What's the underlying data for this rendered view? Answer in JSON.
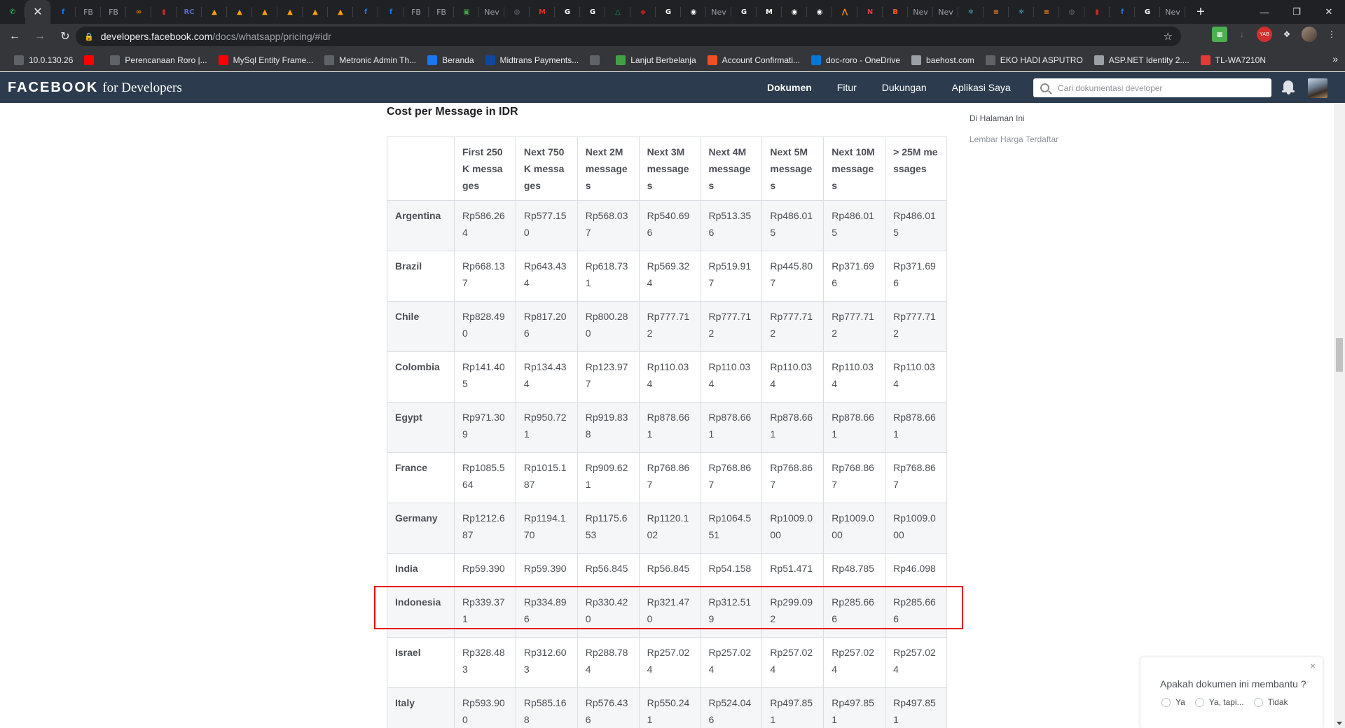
{
  "browser": {
    "tabs": [
      {
        "icon": "whatsapp-icon",
        "color": "#25d366",
        "glyph": "✆"
      },
      {
        "icon": "close-icon",
        "active": true
      },
      {
        "icon": "facebook-icon",
        "color": "#1877f2",
        "glyph": "f"
      },
      {
        "icon": "fb-text",
        "text": "FB"
      },
      {
        "icon": "fb-text",
        "text": "FB"
      },
      {
        "icon": "link-icon",
        "color": "#f57c00",
        "glyph": "∞"
      },
      {
        "icon": "app-icon",
        "color": "#c62828",
        "glyph": "▮"
      },
      {
        "icon": "rc-icon",
        "color": "#5c6bc0",
        "glyph": "RC"
      },
      {
        "icon": "fire-icon",
        "color": "#ffa000",
        "glyph": "▲"
      },
      {
        "icon": "fire-icon",
        "color": "#ffa000",
        "glyph": "▲"
      },
      {
        "icon": "fire-icon",
        "color": "#ffa000",
        "glyph": "▲"
      },
      {
        "icon": "fire-icon",
        "color": "#ffa000",
        "glyph": "▲"
      },
      {
        "icon": "fire-icon",
        "color": "#ffa000",
        "glyph": "▲"
      },
      {
        "icon": "fire-icon",
        "color": "#ffa000",
        "glyph": "▲"
      },
      {
        "icon": "facebook-round-icon",
        "color": "#1877f2",
        "glyph": "f"
      },
      {
        "icon": "facebook-icon",
        "color": "#1877f2",
        "glyph": "f"
      },
      {
        "icon": "fb-text",
        "text": "FB"
      },
      {
        "icon": "fb-text",
        "text": "FB"
      },
      {
        "icon": "course-icon",
        "color": "#43a047",
        "glyph": "▣"
      },
      {
        "icon": "new-tab-text",
        "text": "Nev"
      },
      {
        "icon": "globe-icon",
        "color": "#5f6368",
        "glyph": "◍"
      },
      {
        "icon": "gmail-icon",
        "color": "#d93025",
        "glyph": "M"
      },
      {
        "icon": "google-icon",
        "color": "#ffffff",
        "glyph": "G"
      },
      {
        "icon": "google-icon",
        "color": "#ffffff",
        "glyph": "G"
      },
      {
        "icon": "drive-icon",
        "color": "#0f9d58",
        "glyph": "△"
      },
      {
        "icon": "shield-icon",
        "color": "#b71c1c",
        "glyph": "◆"
      },
      {
        "icon": "google-icon",
        "color": "#ffffff",
        "glyph": "G"
      },
      {
        "icon": "github-icon",
        "color": "#ffffff",
        "glyph": "◉"
      },
      {
        "icon": "new-tab-text",
        "text": "Nev"
      },
      {
        "icon": "google-icon",
        "color": "#ffffff",
        "glyph": "G"
      },
      {
        "icon": "medium-icon",
        "color": "#ffffff",
        "glyph": "M"
      },
      {
        "icon": "github-icon",
        "color": "#ffffff",
        "glyph": "◉"
      },
      {
        "icon": "github-icon",
        "color": "#ffffff",
        "glyph": "◉"
      },
      {
        "icon": "bars-icon",
        "color": "#ff9800",
        "glyph": "⋀"
      },
      {
        "icon": "inbox-icon",
        "color": "#e53935",
        "glyph": "N"
      },
      {
        "icon": "blogger-icon",
        "color": "#ff5722",
        "glyph": "B"
      },
      {
        "icon": "new-tab-text",
        "text": "Nev"
      },
      {
        "icon": "new-tab-text",
        "text": "Nev"
      },
      {
        "icon": "react-icon",
        "color": "#61dafb",
        "glyph": "⚛"
      },
      {
        "icon": "stack-icon",
        "color": "#f48024",
        "glyph": "≡"
      },
      {
        "icon": "react-icon",
        "color": "#61dafb",
        "glyph": "⚛"
      },
      {
        "icon": "stack-icon",
        "color": "#f48024",
        "glyph": "≡"
      },
      {
        "icon": "globe-icon",
        "color": "#5f6368",
        "glyph": "◍"
      },
      {
        "icon": "app-icon",
        "color": "#c62828",
        "glyph": "▮"
      },
      {
        "icon": "facebook-icon",
        "color": "#1877f2",
        "glyph": "f"
      },
      {
        "icon": "google-icon",
        "color": "#ffffff",
        "glyph": "G"
      },
      {
        "icon": "new-tab-text",
        "text": "Nev"
      }
    ],
    "url_host": "developers.facebook.com",
    "url_path": "/docs/whatsapp/pricing/#idr",
    "bookmarks": [
      {
        "icon": "globe-icon",
        "color": "#5f6368",
        "label": "10.0.130.26"
      },
      {
        "icon": "youtube-icon",
        "color": "#ff0000",
        "label": ""
      },
      {
        "icon": "globe-icon",
        "color": "#5f6368",
        "label": "Perencanaan Roro |..."
      },
      {
        "icon": "youtube-icon",
        "color": "#ff0000",
        "label": "MySql Entity Frame..."
      },
      {
        "icon": "globe-icon",
        "color": "#5f6368",
        "label": "Metronic Admin Th..."
      },
      {
        "icon": "facebook-icon",
        "color": "#1877f2",
        "label": "Beranda"
      },
      {
        "icon": "midtrans-icon",
        "color": "#0d47a1",
        "label": "Midtrans Payments..."
      },
      {
        "icon": "globe-icon",
        "color": "#5f6368",
        "label": ""
      },
      {
        "icon": "course-icon",
        "color": "#43a047",
        "label": "Lanjut Berbelanja"
      },
      {
        "icon": "microsoft-icon",
        "color": "#f25022",
        "label": "Account Confirmati..."
      },
      {
        "icon": "onedrive-icon",
        "color": "#0078d4",
        "label": "doc-roro - OneDrive"
      },
      {
        "icon": "search-icon",
        "color": "#9aa0a6",
        "label": "baehost.com"
      },
      {
        "icon": "globe-icon",
        "color": "#5f6368",
        "label": "EKO HADI ASPUTRO"
      },
      {
        "icon": "dotnet-icon",
        "color": "#9aa0a6",
        "label": "ASP.NET Identity 2...."
      },
      {
        "icon": "tplink-icon",
        "color": "#e53935",
        "label": "TL-WA7210N"
      }
    ]
  },
  "fb": {
    "logo": "FACEBOOK",
    "logo_sub": "for Developers",
    "nav": [
      "Dokumen",
      "Fitur",
      "Dukungan",
      "Aplikasi Saya"
    ],
    "search_placeholder": "Cari dokumentasi developer"
  },
  "page": {
    "section_title": "Cost per Message in IDR",
    "toc_head": "Di Halaman Ini",
    "toc_link": "Lembar Harga Terdaftar"
  },
  "table": {
    "headers": [
      "First 250K messages",
      "Next 750K messages",
      "Next 2M messages",
      "Next 3M messages",
      "Next 4M messages",
      "Next 5M messages",
      "Next 10M messages",
      "> 25M messages"
    ],
    "rows": [
      {
        "country": "Argentina",
        "values": [
          "Rp586.264",
          "Rp577.150",
          "Rp568.037",
          "Rp540.696",
          "Rp513.356",
          "Rp486.015",
          "Rp486.015",
          "Rp486.015"
        ]
      },
      {
        "country": "Brazil",
        "values": [
          "Rp668.137",
          "Rp643.434",
          "Rp618.731",
          "Rp569.324",
          "Rp519.917",
          "Rp445.807",
          "Rp371.696",
          "Rp371.696"
        ]
      },
      {
        "country": "Chile",
        "values": [
          "Rp828.490",
          "Rp817.206",
          "Rp800.280",
          "Rp777.712",
          "Rp777.712",
          "Rp777.712",
          "Rp777.712",
          "Rp777.712"
        ]
      },
      {
        "country": "Colombia",
        "values": [
          "Rp141.405",
          "Rp134.434",
          "Rp123.977",
          "Rp110.034",
          "Rp110.034",
          "Rp110.034",
          "Rp110.034",
          "Rp110.034"
        ]
      },
      {
        "country": "Egypt",
        "values": [
          "Rp971.309",
          "Rp950.721",
          "Rp919.838",
          "Rp878.661",
          "Rp878.661",
          "Rp878.661",
          "Rp878.661",
          "Rp878.661"
        ]
      },
      {
        "country": "France",
        "values": [
          "Rp1085.564",
          "Rp1015.187",
          "Rp909.621",
          "Rp768.867",
          "Rp768.867",
          "Rp768.867",
          "Rp768.867",
          "Rp768.867"
        ]
      },
      {
        "country": "Germany",
        "values": [
          "Rp1212.687",
          "Rp1194.170",
          "Rp1175.653",
          "Rp1120.102",
          "Rp1064.551",
          "Rp1009.000",
          "Rp1009.000",
          "Rp1009.000"
        ]
      },
      {
        "country": "India",
        "values": [
          "Rp59.390",
          "Rp59.390",
          "Rp56.845",
          "Rp56.845",
          "Rp54.158",
          "Rp51.471",
          "Rp48.785",
          "Rp46.098"
        ]
      },
      {
        "country": "Indonesia",
        "values": [
          "Rp339.371",
          "Rp334.896",
          "Rp330.420",
          "Rp321.470",
          "Rp312.519",
          "Rp299.092",
          "Rp285.666",
          "Rp285.666"
        ]
      },
      {
        "country": "Israel",
        "values": [
          "Rp328.483",
          "Rp312.603",
          "Rp288.784",
          "Rp257.024",
          "Rp257.024",
          "Rp257.024",
          "Rp257.024",
          "Rp257.024"
        ]
      },
      {
        "country": "Italy",
        "values": [
          "Rp593.900",
          "Rp585.168",
          "Rp576.436",
          "Rp550.241",
          "Rp524.046",
          "Rp497.851",
          "Rp497.851",
          "Rp497.851"
        ]
      }
    ]
  },
  "feedback": {
    "question": "Apakah dokumen ini membantu ?",
    "options": [
      "Ya",
      "Ya, tapi...",
      "Tidak"
    ],
    "close": "×"
  },
  "colors": {
    "header_bg": "#2c3b4d",
    "highlight": "#e8000b",
    "chrome_dark": "#202124",
    "chrome_toolbar": "#35363a"
  }
}
